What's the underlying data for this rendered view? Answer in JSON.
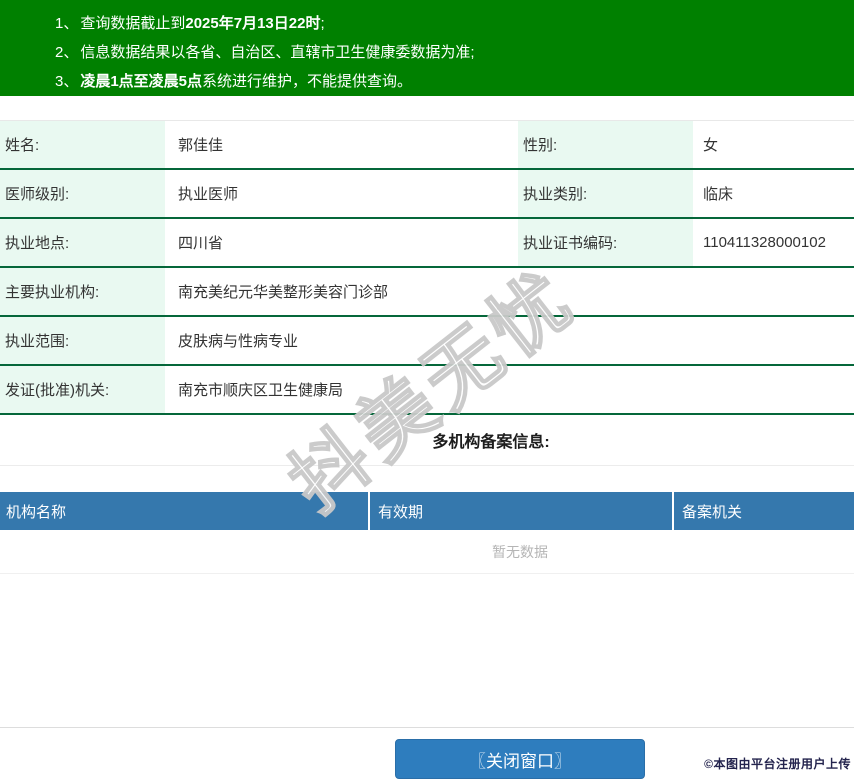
{
  "banner": {
    "bg_color": "#008000",
    "notices": [
      {
        "num": "1、",
        "pre": "查询数据截止到",
        "bold": "2025年7月13日22时",
        "post": ";"
      },
      {
        "num": "2、",
        "pre": "信息数据结果以各省、自治区、直辖市卫生健康委数据为准;",
        "bold": "",
        "post": ""
      },
      {
        "num": "3、",
        "pre": "",
        "bold": "凌晨1点至凌晨5点",
        "post": "系统进行维护，不能提供查询。"
      }
    ]
  },
  "info": {
    "rows": [
      {
        "pairs": [
          {
            "label": "姓名:",
            "value": "郭佳佳"
          },
          {
            "label": "性别:",
            "value": "女"
          }
        ]
      },
      {
        "pairs": [
          {
            "label": "医师级别:",
            "value": "执业医师"
          },
          {
            "label": "执业类别:",
            "value": "临床"
          }
        ]
      },
      {
        "pairs": [
          {
            "label": "执业地点:",
            "value": "四川省"
          },
          {
            "label": "执业证书编码:",
            "value": "110411328000102"
          }
        ]
      },
      {
        "pairs": [
          {
            "label": "主要执业机构:",
            "value": "南充美纪元华美整形美容门诊部"
          }
        ]
      },
      {
        "pairs": [
          {
            "label": "执业范围:",
            "value": "皮肤病与性病专业"
          }
        ]
      },
      {
        "pairs": [
          {
            "label": "发证(批准)机关:",
            "value": "南充市顺庆区卫生健康局"
          }
        ]
      }
    ]
  },
  "multi_org": {
    "heading": "多机构备案信息:",
    "columns": [
      "机构名称",
      "有效期",
      "备案机关"
    ],
    "empty_text": "暂无数据"
  },
  "footer": {
    "close_button": "〖关闭窗口〗",
    "copyright": "©本图由平台注册用户上传"
  },
  "watermark": {
    "text": "抖美无忧"
  },
  "colors": {
    "banner_green": "#008000",
    "row_divider_green": "#05673a",
    "label_cell_mint": "#e9f9f1",
    "table_header_blue": "#3578ad",
    "button_blue": "#2e7dbe",
    "empty_text_gray": "#b5b5b5"
  }
}
